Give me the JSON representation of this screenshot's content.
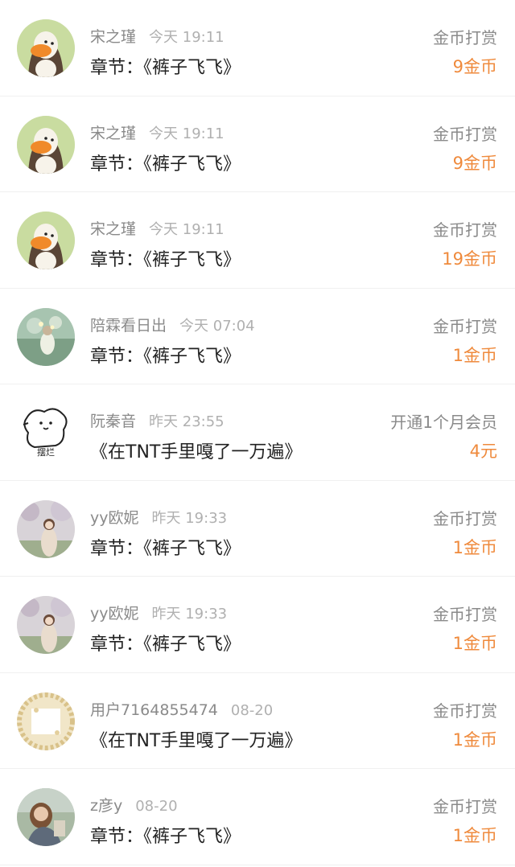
{
  "rows": [
    {
      "avatar": "duck-avatar",
      "name": "宋之瑾",
      "time": "今天 19:11",
      "content": "章节：《裤子飞飞》",
      "action": "金币打赏",
      "amount": "9金币"
    },
    {
      "avatar": "duck-avatar",
      "name": "宋之瑾",
      "time": "今天 19:11",
      "content": "章节：《裤子飞飞》",
      "action": "金币打赏",
      "amount": "9金币"
    },
    {
      "avatar": "duck-avatar",
      "name": "宋之瑾",
      "time": "今天 19:11",
      "content": "章节：《裤子飞飞》",
      "action": "金币打赏",
      "amount": "19金币"
    },
    {
      "avatar": "photo-avatar-green",
      "name": "陪霖看日出",
      "time": "今天 07:04",
      "content": "章节：《裤子飞飞》",
      "action": "金币打赏",
      "amount": "1金币"
    },
    {
      "avatar": "sketch-avatar",
      "name": "阮秦音",
      "time": "昨天 23:55",
      "content": "《在TNT手里嘎了一万遍》",
      "action": "开通1个月会员",
      "amount": "4元",
      "avatar_text": "摆烂"
    },
    {
      "avatar": "photo-avatar-girl",
      "name": "yy欧妮",
      "time": "昨天 19:33",
      "content": "章节：《裤子飞飞》",
      "action": "金币打赏",
      "amount": "1金币"
    },
    {
      "avatar": "photo-avatar-girl",
      "name": "yy欧妮",
      "time": "昨天 19:33",
      "content": "章节：《裤子飞飞》",
      "action": "金币打赏",
      "amount": "1金币"
    },
    {
      "avatar": "frame-avatar",
      "name": "用户7164855474",
      "time": "08-20",
      "content": "《在TNT手里嘎了一万遍》",
      "action": "金币打赏",
      "amount": "1金币"
    },
    {
      "avatar": "photo-avatar-portrait",
      "name": "z彦y",
      "time": "08-20",
      "content": "章节：《裤子飞飞》",
      "action": "金币打赏",
      "amount": "1金币"
    }
  ],
  "colors": {
    "amount": "#ef8a3c",
    "name": "#8a8a8a",
    "time": "#b0b0b0",
    "content": "#222222"
  }
}
